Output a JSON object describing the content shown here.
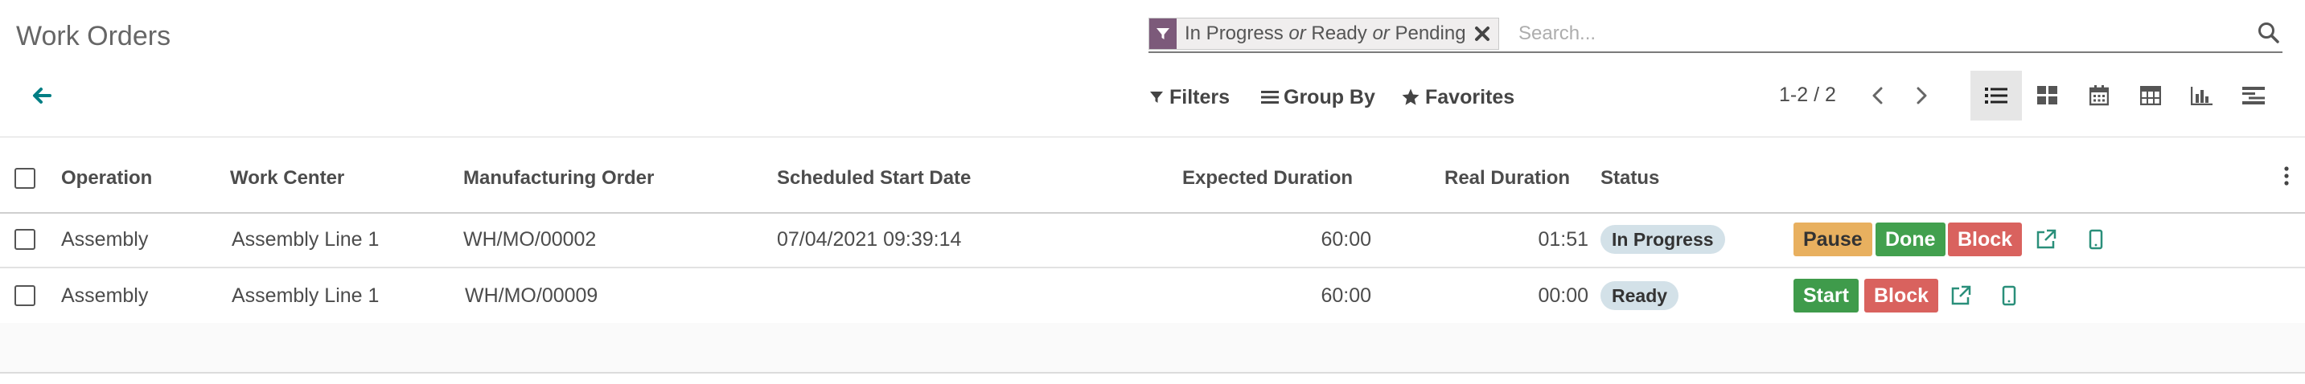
{
  "page": {
    "title": "Work Orders"
  },
  "search": {
    "facet_parts": [
      "In Progress",
      "or",
      "Ready",
      "or",
      "Pending"
    ],
    "placeholder": "Search..."
  },
  "toolbar": {
    "filters": "Filters",
    "group_by": "Group By",
    "favorites": "Favorites"
  },
  "pager": {
    "value": "1-2 / 2"
  },
  "views": [
    "list-view",
    "kanban-view",
    "calendar-view",
    "pivot-view",
    "graph-view",
    "gantt-view"
  ],
  "active_view": "list-view",
  "table": {
    "columns": {
      "operation": "Operation",
      "work_center": "Work Center",
      "manufacturing_order": "Manufacturing Order",
      "scheduled_start": "Scheduled Start Date",
      "expected_duration": "Expected Duration",
      "real_duration": "Real Duration",
      "status": "Status"
    },
    "rows": [
      {
        "operation": "Assembly",
        "work_center": "Assembly Line 1",
        "manufacturing_order": "WH/MO/00002",
        "scheduled_start": "07/04/2021 09:39:14",
        "expected_duration": "60:00",
        "real_duration": "01:51",
        "status": "In Progress",
        "actions": [
          "Pause",
          "Done",
          "Block"
        ]
      },
      {
        "operation": "Assembly",
        "work_center": "Assembly Line 1",
        "manufacturing_order": "WH/MO/00009",
        "scheduled_start": "",
        "expected_duration": "60:00",
        "real_duration": "00:00",
        "status": "Ready",
        "actions": [
          "Start",
          "Block"
        ]
      }
    ]
  },
  "colors": {
    "facet_icon": "#7c5a7a",
    "accent": "#017e84",
    "pause": "#e8b05f",
    "done": "#42a04e",
    "block": "#d9625e",
    "status_badge": "#d3e1e8"
  }
}
